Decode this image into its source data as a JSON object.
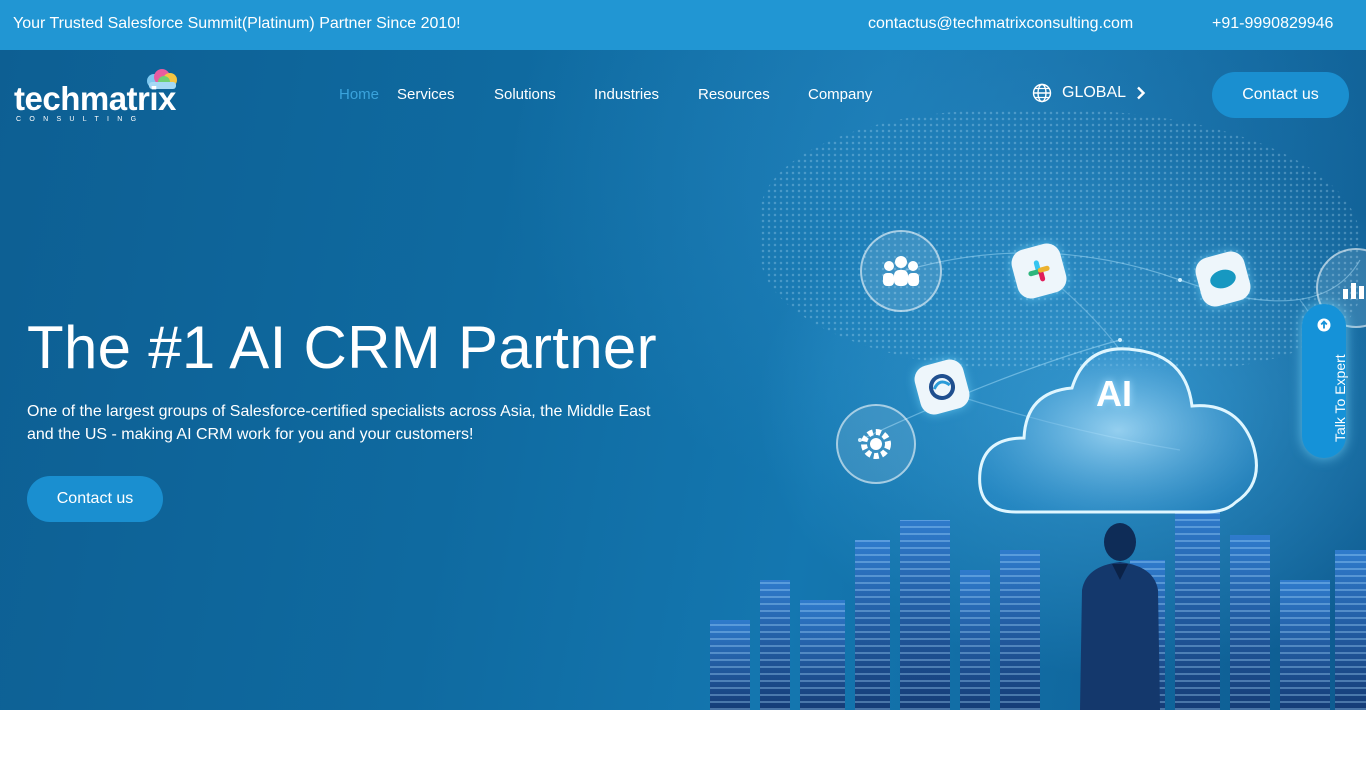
{
  "topbar": {
    "tagline": "Your Trusted Salesforce Summit(Platinum) Partner Since 2010!",
    "email": "contactus@techmatrixconsulting.com",
    "phone": "+91-9990829946"
  },
  "logo": {
    "wordmark": "techmatrix",
    "sub": "CONSULTING"
  },
  "nav": {
    "items": [
      "Home",
      "Services",
      "Solutions",
      "Industries",
      "Resources",
      "Company"
    ],
    "active": "Home"
  },
  "region": {
    "label": "GLOBAL"
  },
  "header_cta": {
    "label": "Contact us"
  },
  "hero": {
    "title": "The #1 AI CRM Partner",
    "description": "One of the largest groups of Salesforce-certified specialists across Asia, the Middle East and the US - making AI CRM work for you and your customers!",
    "cta_label": "Contact us",
    "ai_label": "AI"
  },
  "side_tab": {
    "label": "Talk To Expert"
  },
  "colors": {
    "topbar": "#2196d3",
    "button": "#1a8fd0",
    "nav_active": "#3aa3dc",
    "hero_dark": "#0d5f93"
  },
  "icons": [
    "globe-icon",
    "chevron-right-icon",
    "arrow-up-circle-icon",
    "team-icon",
    "gear-icon",
    "slack-icon",
    "salesforce-icon",
    "loop-icon",
    "chart-icon"
  ]
}
